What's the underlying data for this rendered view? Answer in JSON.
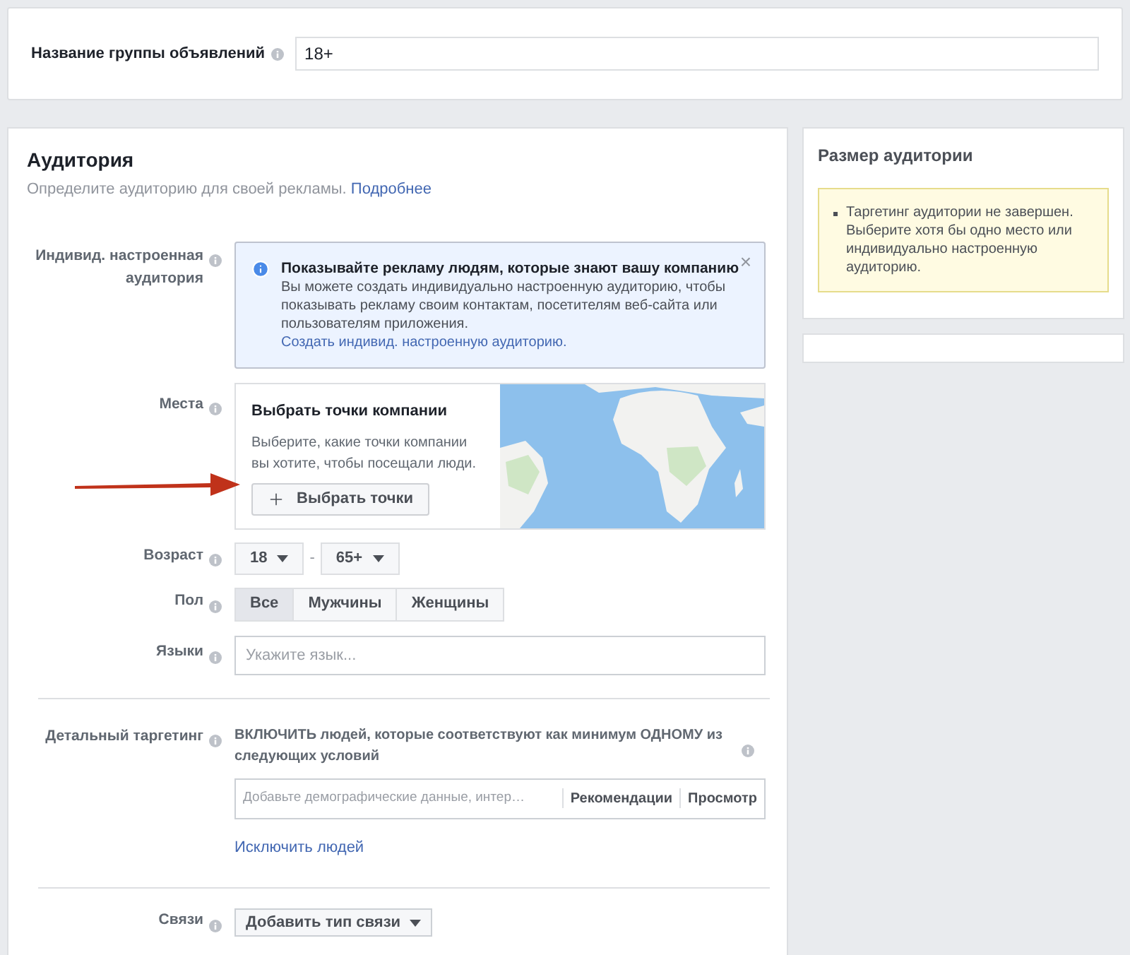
{
  "ad_set_name": {
    "label": "Название группы объявлений",
    "value": "18+"
  },
  "audience": {
    "title": "Аудитория",
    "subtitle": "Определите аудиторию для своей рекламы.",
    "subtitle_link": "Подробнее",
    "custom_audience": {
      "label": "Индивид. настроенная аудитория",
      "notice_title": "Показывайте рекламу людям, которые знают вашу компанию",
      "notice_text": "Вы можете создать индивидуально настроенную аудиторию, чтобы показывать рекламу своим контактам, посетителям веб-сайта или пользователям приложения.",
      "notice_link": "Создать индивид. настроенную аудиторию.",
      "close": "×"
    },
    "places": {
      "label": "Места",
      "title": "Выбрать точки компании",
      "text": "Выберите, какие точки компании вы хотите, чтобы посещали люди.",
      "button": "Выбрать точки"
    },
    "age": {
      "label": "Возраст",
      "from": "18",
      "separator": "-",
      "to": "65+"
    },
    "gender": {
      "label": "Пол",
      "options": [
        {
          "label": "Все",
          "selected": true
        },
        {
          "label": "Мужчины",
          "selected": false
        },
        {
          "label": "Женщины",
          "selected": false
        }
      ]
    },
    "languages": {
      "label": "Языки",
      "placeholder": "Укажите язык..."
    },
    "detailed_targeting": {
      "label": "Детальный таргетинг",
      "description": "ВКЛЮЧИТЬ людей, которые соответствуют как минимум ОДНОМУ из следующих условий",
      "placeholder": "Добавьте демографические данные, интер…",
      "suggestions": "Рекомендации",
      "browse": "Просмотр",
      "exclude_link": "Исключить людей"
    },
    "connections": {
      "label": "Связи",
      "button": "Добавить тип связи"
    }
  },
  "audience_size": {
    "title": "Размер аудитории",
    "warning": "Таргетинг аудитории не завершен. Выберите хотя бы одно место или индивидуально настроенную аудиторию."
  }
}
